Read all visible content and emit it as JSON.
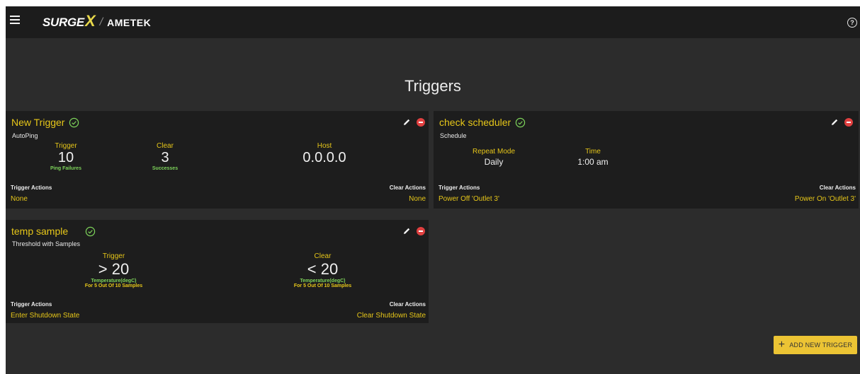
{
  "header": {
    "logo_surge": "SURGE",
    "logo_x": "X",
    "logo_separator": "/",
    "logo_ametek": "AMETEK",
    "help_label": "?"
  },
  "page": {
    "title": "Triggers"
  },
  "triggers": [
    {
      "name": "New Trigger",
      "type": "AutoPing",
      "metrics": [
        {
          "label": "Trigger",
          "value": "10",
          "sub": "Ping Failures"
        },
        {
          "label": "Clear",
          "value": "3",
          "sub": "Successes"
        },
        {
          "label": "Host",
          "value": "0.0.0.0",
          "sub": ""
        }
      ],
      "trigger_actions_label": "Trigger Actions",
      "trigger_actions_value": "None",
      "clear_actions_label": "Clear Actions",
      "clear_actions_value": "None"
    },
    {
      "name": "check scheduler",
      "type": "Schedule",
      "metrics": [
        {
          "label": "Repeat Mode",
          "value": "Daily"
        },
        {
          "label": "Time",
          "value": "1:00 am"
        }
      ],
      "trigger_actions_label": "Trigger Actions",
      "trigger_actions_value": "Power Off 'Outlet 3'",
      "clear_actions_label": "Clear Actions",
      "clear_actions_value": "Power On 'Outlet 3'"
    },
    {
      "name": "temp sample",
      "type": "Threshold with Samples",
      "metrics": [
        {
          "label": "Trigger",
          "value": "> 20",
          "sub": "Temperature(degC)",
          "sub2": "For 5 Out Of 10 Samples"
        },
        {
          "label": "Clear",
          "value": "< 20",
          "sub": "Temperature(degC)",
          "sub2": "For 5 Out Of 10 Samples"
        }
      ],
      "trigger_actions_label": "Trigger Actions",
      "trigger_actions_value": "Enter Shutdown State",
      "clear_actions_label": "Clear Actions",
      "clear_actions_value": "Clear Shutdown State"
    }
  ],
  "add_button": {
    "label": "ADD NEW TRIGGER",
    "icon": "+"
  },
  "colors": {
    "accent": "#e6c619",
    "success": "#7dd35a",
    "danger": "#e04040",
    "card_bg": "#1d1d1d",
    "page_bg": "#2c2c2c",
    "header_bg": "#1c1c1c"
  },
  "icons": {
    "menu": "hamburger-menu-icon",
    "help": "help-circle-icon",
    "status": "check-circle-icon",
    "edit": "pencil-icon",
    "delete": "minus-circle-icon"
  }
}
